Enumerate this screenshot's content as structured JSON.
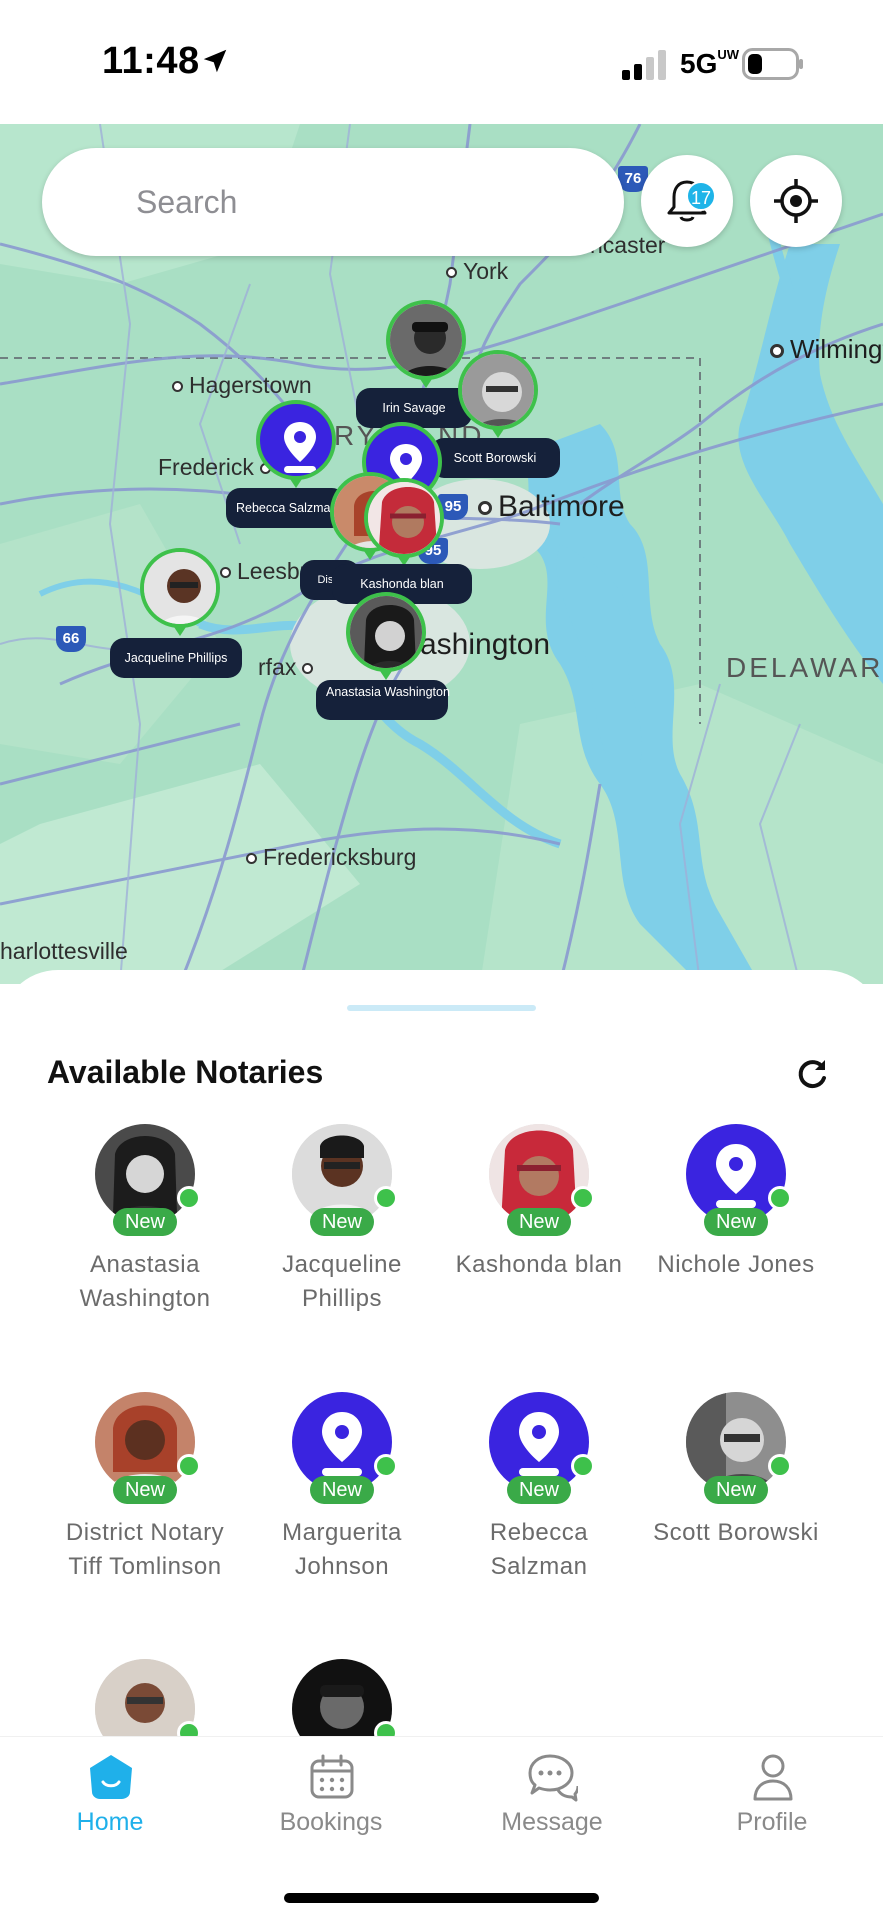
{
  "status_bar": {
    "time": "11:48",
    "network": "5G",
    "network_sup": "UW"
  },
  "search": {
    "placeholder": "Search"
  },
  "notifications": {
    "count": "17"
  },
  "map": {
    "cities": [
      {
        "name": "York"
      },
      {
        "name": "Hagerstown"
      },
      {
        "name": "Frederick"
      },
      {
        "name": "Baltimore"
      },
      {
        "name": "Leesbu"
      },
      {
        "name": "rfax"
      },
      {
        "name": "ashington"
      },
      {
        "name": "Fredericksburg"
      },
      {
        "name": "harlottesville"
      },
      {
        "name": "Wilmingt"
      },
      {
        "name": "ncaster"
      },
      {
        "name": "DELAWAR"
      },
      {
        "name": "RY"
      },
      {
        "name": "ND"
      }
    ],
    "highway_shields": [
      "76",
      "66",
      "95",
      "95"
    ],
    "marker_labels": [
      {
        "text": "Irin Savage"
      },
      {
        "text": "Scott Borowski"
      },
      {
        "text": "Rebecca Salzman"
      },
      {
        "text": "Distri"
      },
      {
        "text": "Kashonda blan"
      },
      {
        "text": "Jacqueline Phillips"
      },
      {
        "text": "Anastasia Washington"
      }
    ]
  },
  "sheet": {
    "title": "Available Notaries",
    "badge_text": "New",
    "notaries": [
      {
        "name": "Anastasia Washington",
        "avatar": "photo"
      },
      {
        "name": "Jacqueline Phillips",
        "avatar": "photo"
      },
      {
        "name": "Kashonda blan",
        "avatar": "photo"
      },
      {
        "name": "Nichole Jones",
        "avatar": "pin"
      },
      {
        "name": "District Notary Tiff Tomlinson",
        "avatar": "photo"
      },
      {
        "name": "Marguerita Johnson",
        "avatar": "pin"
      },
      {
        "name": "Rebecca Salzman",
        "avatar": "pin"
      },
      {
        "name": "Scott Borowski",
        "avatar": "photo"
      },
      {
        "name": "",
        "avatar": "photo"
      },
      {
        "name": "",
        "avatar": "photo"
      }
    ]
  },
  "tabs": [
    {
      "label": "Home",
      "icon": "home-icon",
      "active": true
    },
    {
      "label": "Bookings",
      "icon": "calendar-icon",
      "active": false
    },
    {
      "label": "Message",
      "icon": "chat-icon",
      "active": false
    },
    {
      "label": "Profile",
      "icon": "person-icon",
      "active": false
    }
  ],
  "colors": {
    "accent": "#1fb0ea",
    "online": "#3ec14b",
    "pin_avatar": "#3a24e0",
    "marker_label_bg": "#15213a"
  }
}
